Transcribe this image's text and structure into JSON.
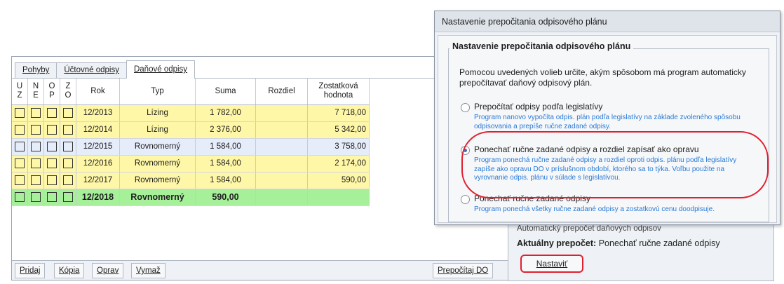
{
  "tabs": [
    {
      "label": "Pohyby",
      "active": false
    },
    {
      "label": "Účtovné odpisy",
      "active": false
    },
    {
      "label": "Daňové odpisy",
      "active": true
    }
  ],
  "grid": {
    "flag_headers": [
      {
        "top": "U",
        "bottom": "Z"
      },
      {
        "top": "N",
        "bottom": "E"
      },
      {
        "top": "O",
        "bottom": "P"
      },
      {
        "top": "Z",
        "bottom": "O"
      }
    ],
    "headers": {
      "rok": "Rok",
      "typ": "Typ",
      "suma": "Suma",
      "rozdiel": "Rozdiel",
      "zostatkova": "Zostatková hodnota"
    },
    "rows": [
      {
        "rok": "12/2013",
        "typ": "Lízing",
        "suma": "1 782,00",
        "rozdiel": "",
        "zostatkova": "7 718,00",
        "color": "yellow"
      },
      {
        "rok": "12/2014",
        "typ": "Lízing",
        "suma": "2 376,00",
        "rozdiel": "",
        "zostatkova": "5 342,00",
        "color": "yellow"
      },
      {
        "rok": "12/2015",
        "typ": "Rovnomerný",
        "suma": "1 584,00",
        "rozdiel": "",
        "zostatkova": "3 758,00",
        "color": "blue"
      },
      {
        "rok": "12/2016",
        "typ": "Rovnomerný",
        "suma": "1 584,00",
        "rozdiel": "",
        "zostatkova": "2 174,00",
        "color": "yellow"
      },
      {
        "rok": "12/2017",
        "typ": "Rovnomerný",
        "suma": "1 584,00",
        "rozdiel": "",
        "zostatkova": "590,00",
        "color": "yellow"
      },
      {
        "rok": "12/2018",
        "typ": "Rovnomerný",
        "suma": "590,00",
        "rozdiel": "",
        "zostatkova": "",
        "color": "green"
      }
    ]
  },
  "bottom_buttons": {
    "pridaj": "Pridaj",
    "kopia": "Kópia",
    "oprav": "Oprav",
    "vymaz": "Vymaž",
    "prepocitaj": "Prepočítaj DO"
  },
  "status": {
    "auto_label": "Automatický prepočet daňových odpisov",
    "current_label": "Aktuálny prepočet:",
    "current_value": "Ponechať ručne zadané odpisy",
    "nastavit": "Nastaviť"
  },
  "dialog": {
    "title": "Nastavenie prepočitania odpisového plánu",
    "group_title": "Nastavenie prepočitania odpisového plánu",
    "intro": "Pomocou uvedených volieb určite, akým spôsobom má program automaticky prepočítavať daňový odpisový plán.",
    "options": [
      {
        "label": "Prepočítať odpisy podľa legislatívy",
        "desc": "Program nanovo vypočíta odpis. plán podľa legislatívy na základe zvoleného spôsobu odpisovania a prepíše ručne zadané odpisy.",
        "selected": false
      },
      {
        "label": "Ponechať ručne zadané odpisy a rozdiel zapísať ako opravu",
        "desc": "Program ponechá ručne zadané odpisy a rozdiel oproti odpis. plánu podľa legislatívy zapíše ako opravu DO v príslušnom období, ktorého sa to týka. Voľbu použite na vyrovnanie odpis. plánu v súlade s legislatívou.",
        "selected": true
      },
      {
        "label": "Ponechať ručne zadané odpisy",
        "desc": "Program ponechá všetky ručne zadané odpisy a zostatkovú cenu doodpisuje.",
        "selected": false
      }
    ]
  },
  "colors": {
    "row_yellow": "#fff7a8",
    "row_blue": "#e5ecfa",
    "row_green": "#a6f09a",
    "highlight_red": "#e02030",
    "desc_blue": "#2a7bd6"
  }
}
